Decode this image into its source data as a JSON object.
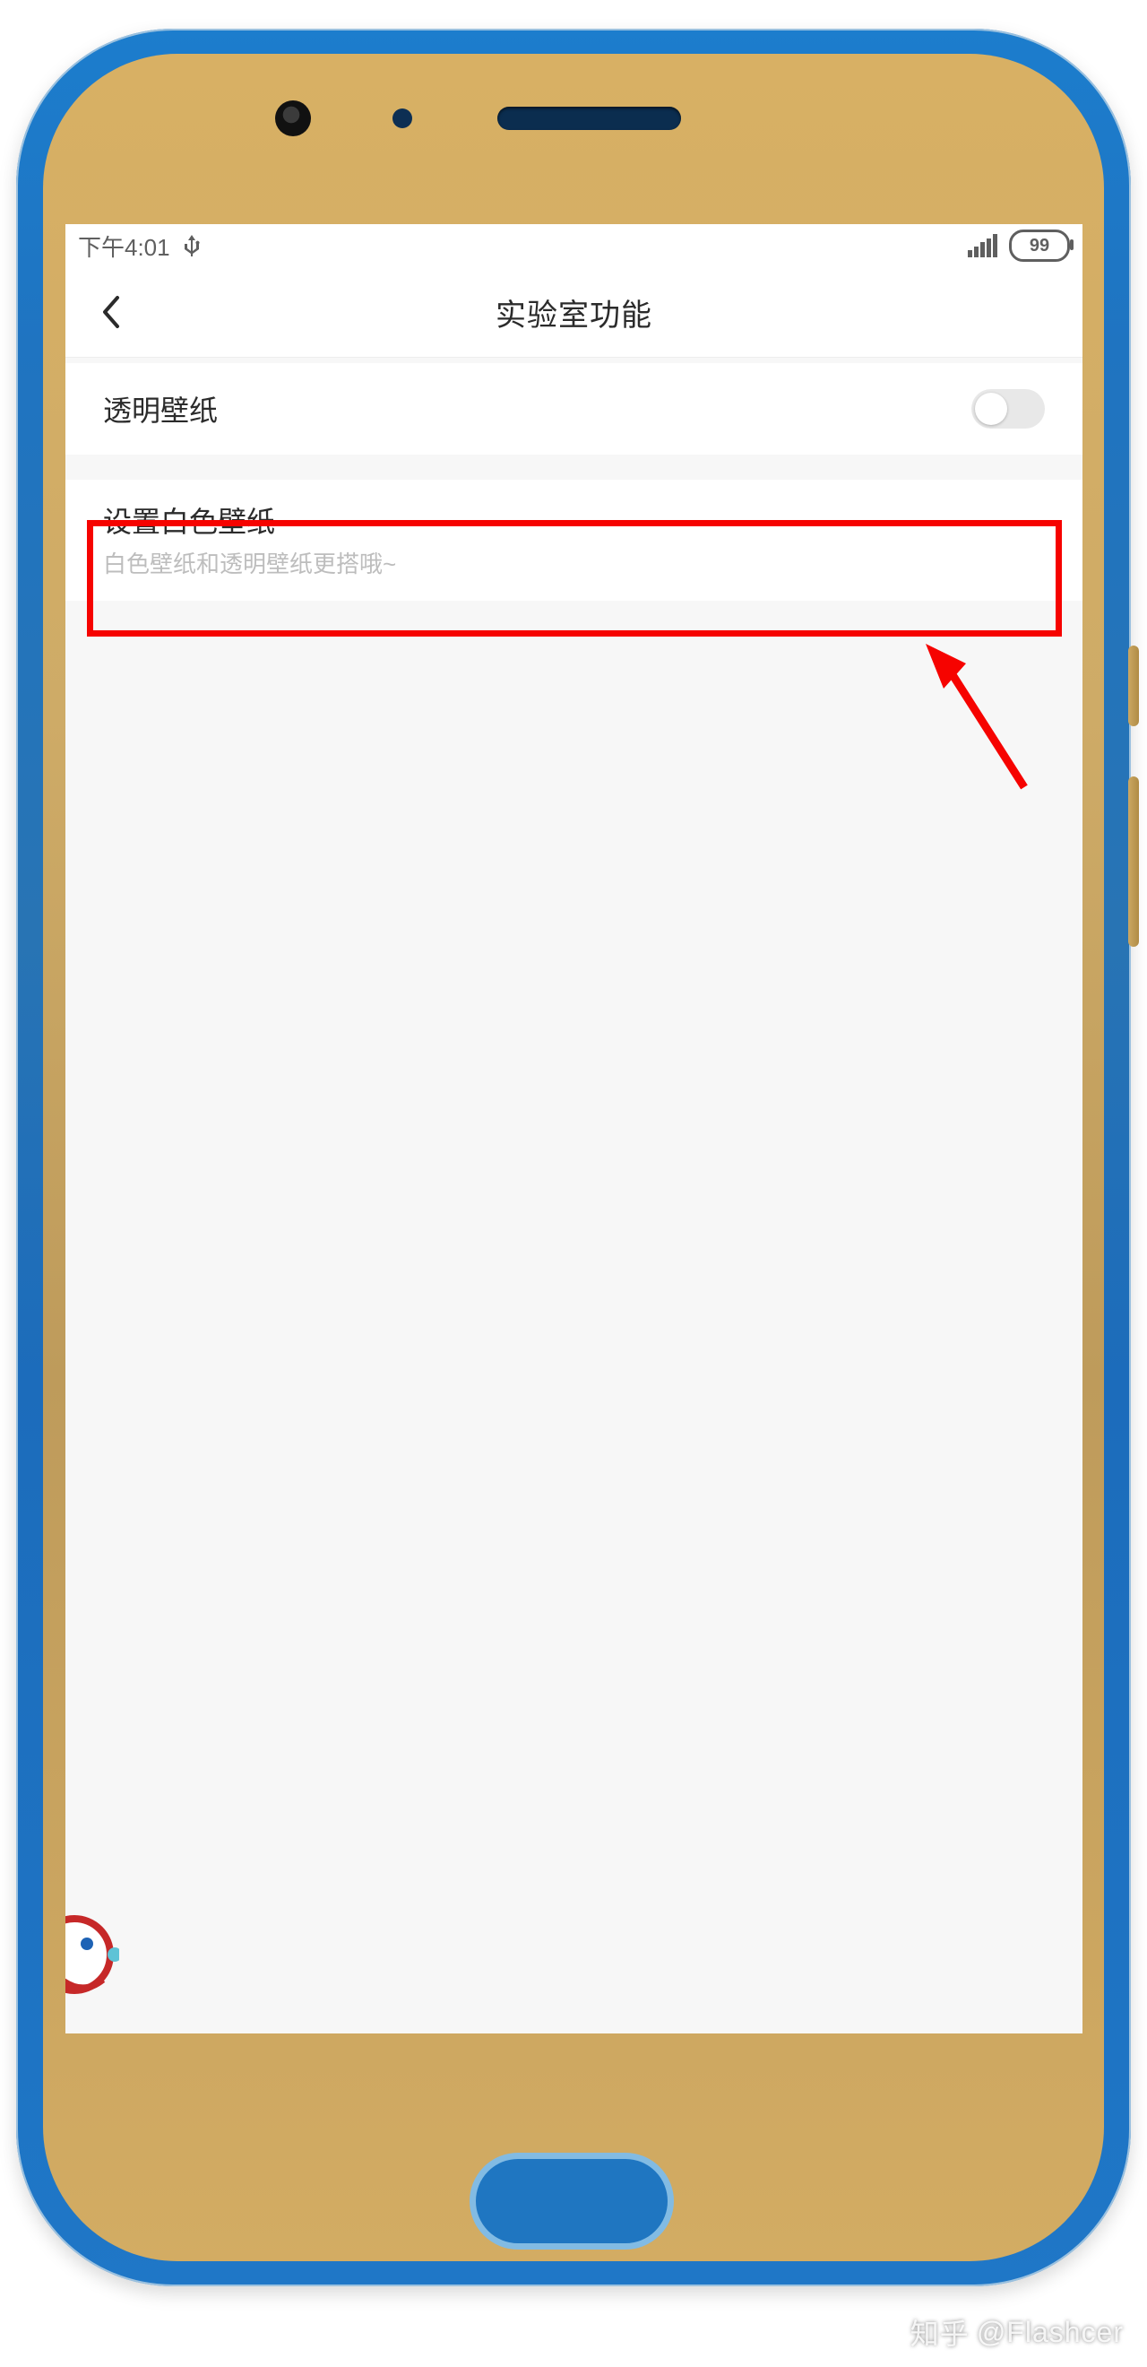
{
  "status": {
    "time": "下午4:01",
    "usb_icon": "usb-icon",
    "signal_icon": "signal-icon",
    "battery_level": "99"
  },
  "title": {
    "text": "实验室功能",
    "back_icon": "chevron-left-icon"
  },
  "settings": {
    "transparent_wallpaper": {
      "label": "透明壁纸",
      "enabled": false
    },
    "white_wallpaper": {
      "label": "设置白色壁纸",
      "subtitle": "白色壁纸和透明壁纸更搭哦~"
    }
  },
  "annotation": {
    "highlight": "white_wallpaper_row",
    "arrow": "points-to-highlight"
  },
  "watermark": {
    "site": "知乎",
    "handle": "@Flashcer"
  },
  "colors": {
    "frame_blue": "#1f77c6",
    "frame_gold": "#cfa962",
    "annotation_red": "#f60300",
    "text_primary": "#2b2b2b",
    "text_secondary": "#bdbdbd",
    "switch_off_bg": "#e8e8e8"
  }
}
